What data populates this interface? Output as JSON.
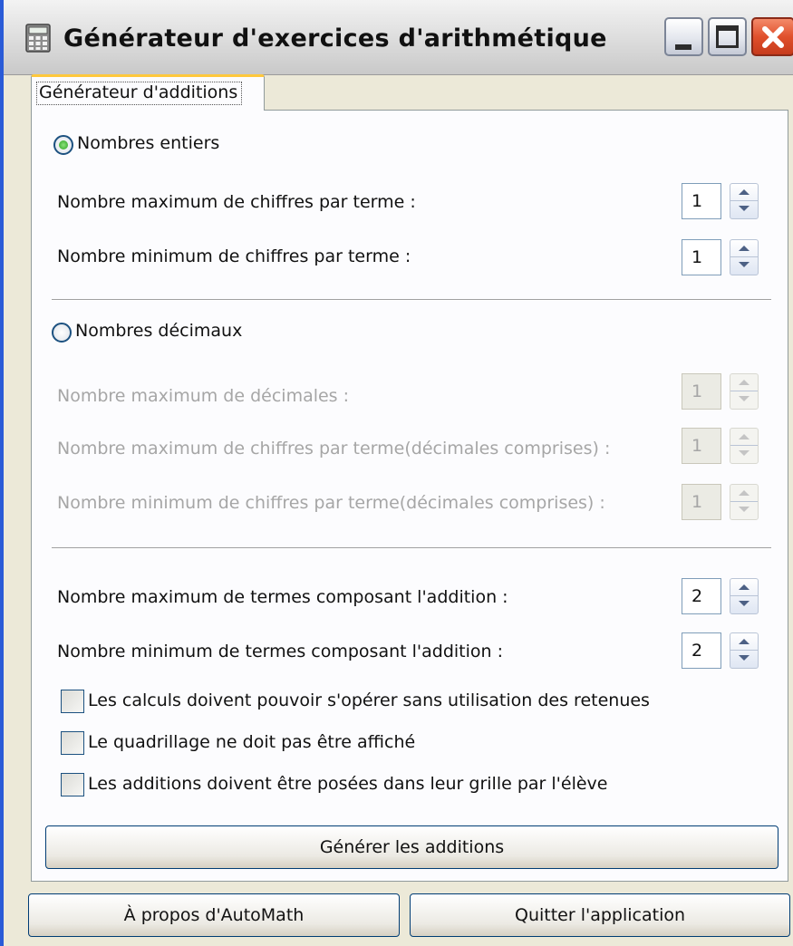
{
  "window": {
    "title": "Générateur d'exercices d'arithmétique"
  },
  "tabs": [
    {
      "label": "Générateur d'additions",
      "selected": true
    }
  ],
  "integers": {
    "radio_label": "Nombres entiers",
    "selected": true,
    "max_digits_label": "Nombre maximum de chiffres par terme :",
    "max_digits_value": "1",
    "min_digits_label": "Nombre minimum de chiffres par terme :",
    "min_digits_value": "1"
  },
  "decimals": {
    "radio_label": "Nombres décimaux",
    "selected": false,
    "max_decimals_label": "Nombre maximum de décimales :",
    "max_decimals_value": "1",
    "max_digits_label": "Nombre maximum de chiffres par terme(décimales comprises) :",
    "max_digits_value": "1",
    "min_digits_label": "Nombre minimum de chiffres par terme(décimales comprises) :",
    "min_digits_value": "1"
  },
  "terms": {
    "max_label": "Nombre maximum de termes composant l'addition :",
    "max_value": "2",
    "min_label": "Nombre minimum de termes composant l'addition :",
    "min_value": "2"
  },
  "options": [
    {
      "label": "Les calculs doivent pouvoir s'opérer sans utilisation des retenues",
      "checked": false
    },
    {
      "label": "Le quadrillage ne doit pas être affiché",
      "checked": false
    },
    {
      "label": "Les additions doivent être posées dans leur grille par l'élève",
      "checked": false
    }
  ],
  "buttons": {
    "generate": "Générer les additions",
    "about": "À propos d'AutoMath",
    "quit": "Quitter l'application"
  },
  "colors": {
    "radio_selected": "#2aa21e",
    "tab_highlight": "#ffc83c",
    "close_button": "#e0502c"
  }
}
